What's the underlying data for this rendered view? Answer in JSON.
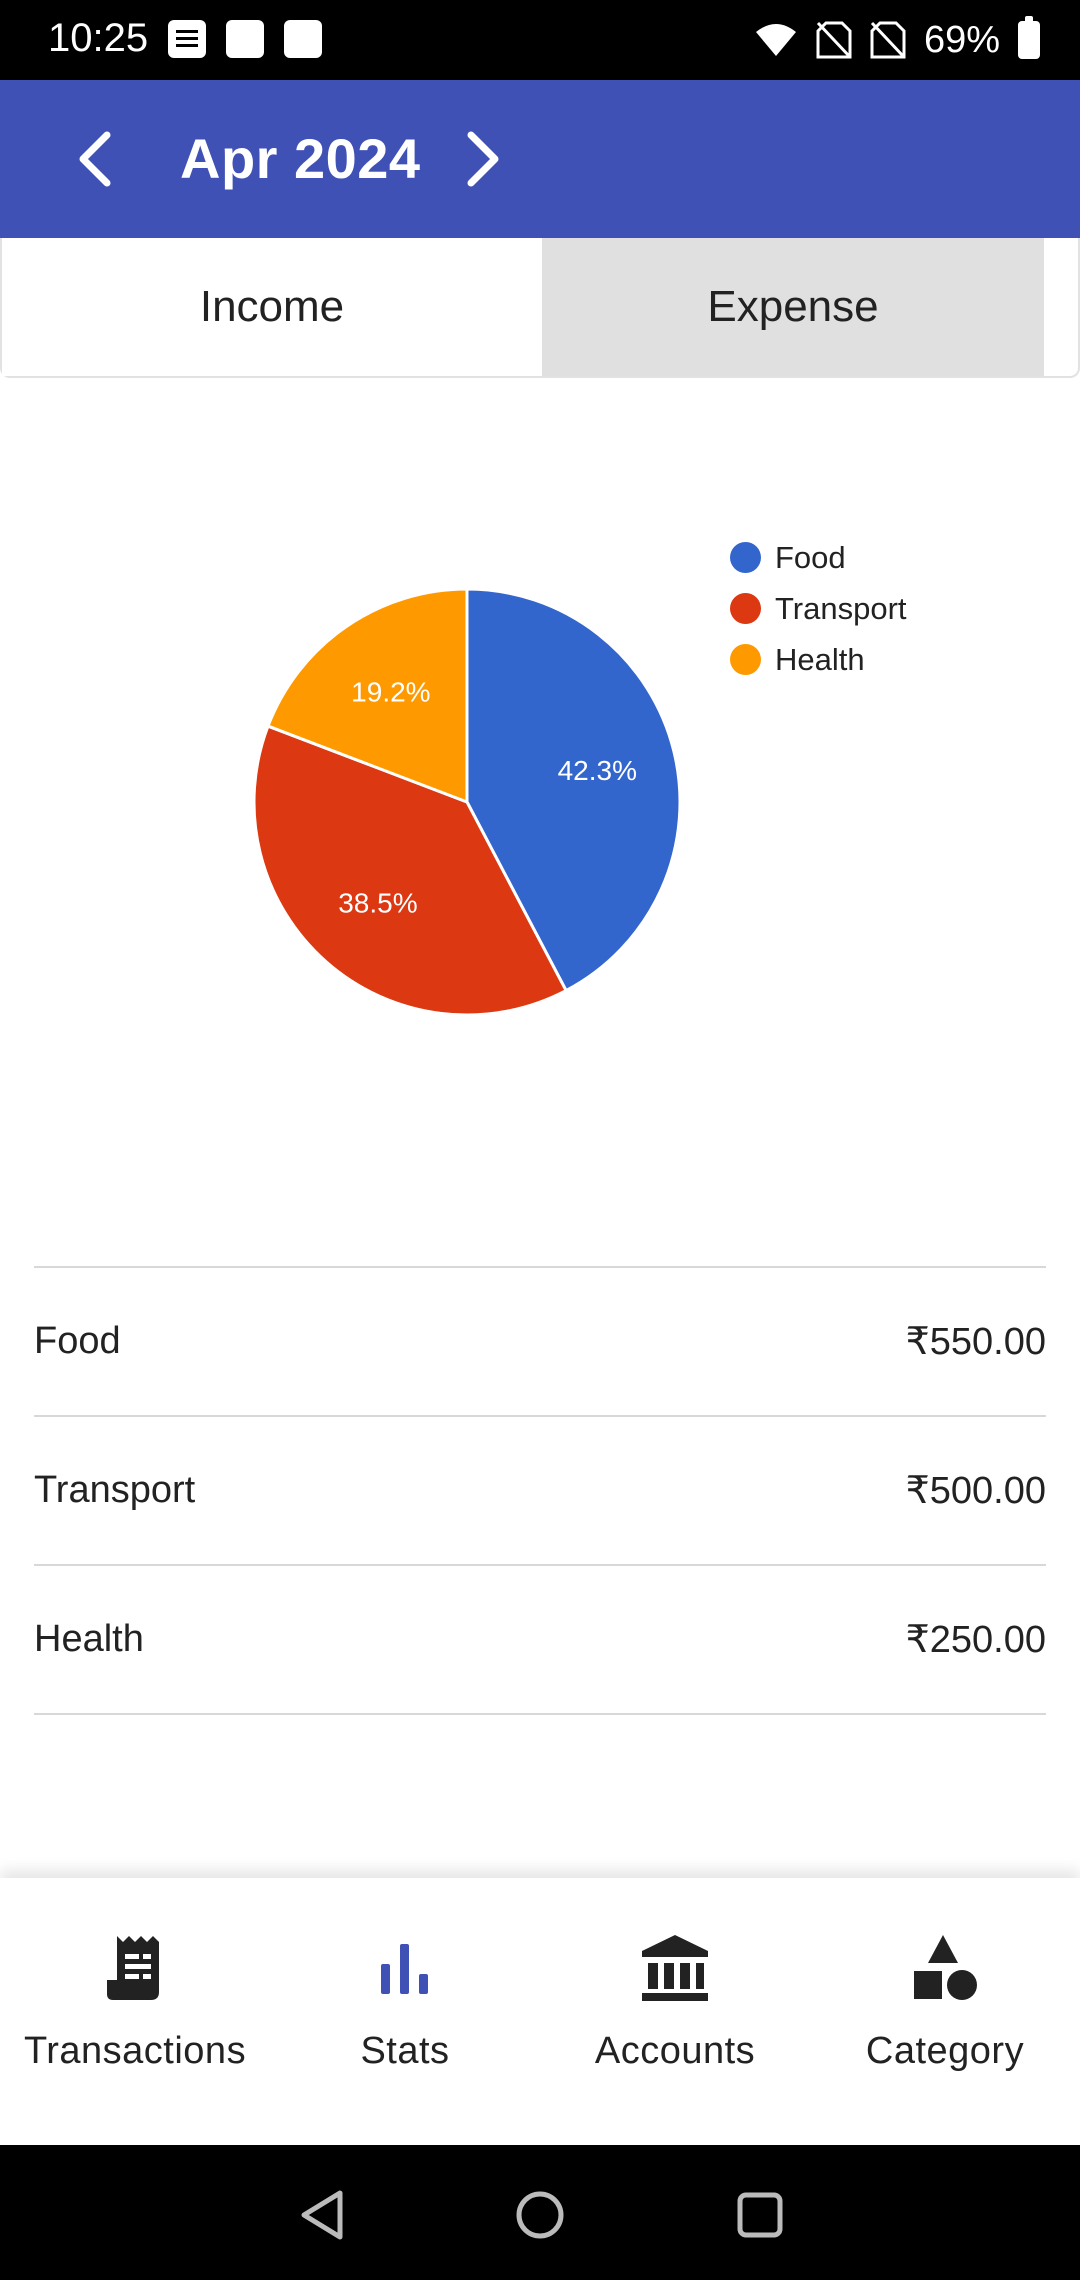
{
  "status_bar": {
    "time": "10:25",
    "battery_text": "69%",
    "icons": [
      "document-notification-icon",
      "notification-icon",
      "notification-icon",
      "wifi-icon",
      "no-sim-icon",
      "no-sim-icon",
      "battery-icon"
    ]
  },
  "header": {
    "month_label": "Apr 2024",
    "prev_icon": "chevron-left-icon",
    "next_icon": "chevron-right-icon",
    "background_color": "#3f51b5"
  },
  "tabs": [
    {
      "label": "Income",
      "selected": false
    },
    {
      "label": "Expense",
      "selected": true
    }
  ],
  "chart_data": {
    "type": "pie",
    "categories": [
      "Food",
      "Transport",
      "Health"
    ],
    "values": [
      42.3,
      38.5,
      19.2
    ],
    "labels": [
      "42.3%",
      "38.5%",
      "19.2%"
    ],
    "colors": [
      "#3366cc",
      "#dc3912",
      "#ff9900"
    ],
    "legend_position": "right"
  },
  "categories": [
    {
      "name": "Food",
      "amount": "₹550.00"
    },
    {
      "name": "Transport",
      "amount": "₹500.00"
    },
    {
      "name": "Health",
      "amount": "₹250.00"
    }
  ],
  "bottom_nav": [
    {
      "label": "Transactions",
      "icon": "receipt-icon",
      "active": false
    },
    {
      "label": "Stats",
      "icon": "bar-chart-icon",
      "active": true
    },
    {
      "label": "Accounts",
      "icon": "bank-icon",
      "active": false
    },
    {
      "label": "Category",
      "icon": "shapes-icon",
      "active": false
    }
  ],
  "system_nav": [
    "back-icon",
    "home-icon",
    "recents-icon"
  ],
  "colors": {
    "accent": "#3f51b5",
    "selected_tab": "#e0e0e0"
  }
}
